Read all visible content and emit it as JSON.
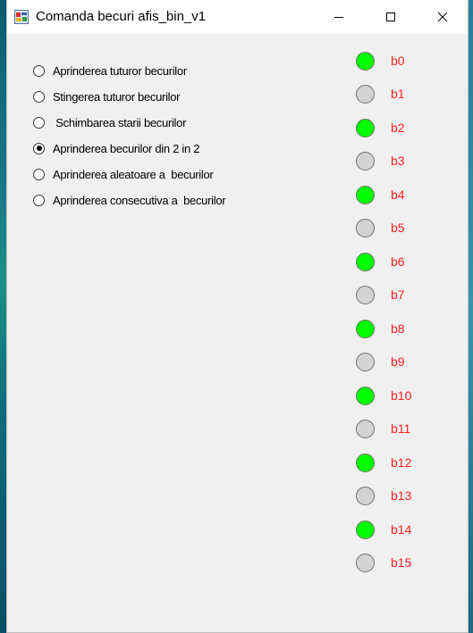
{
  "window": {
    "title": "Comanda becuri afis_bin_v1",
    "controls": {
      "minimize": "minimize",
      "maximize": "maximize",
      "close": "close"
    }
  },
  "options": [
    {
      "label": "Aprinderea tuturor becurilor",
      "checked": false
    },
    {
      "label": "Stingerea tuturor becurilor",
      "checked": false
    },
    {
      "label": " Schimbarea starii becurilor",
      "checked": false
    },
    {
      "label": "Aprinderea becurilor din 2 in 2",
      "checked": true
    },
    {
      "label": "Aprinderea aleatoare a  becurilor",
      "checked": false
    },
    {
      "label": "Aprinderea consecutiva a  becurilor",
      "checked": false
    }
  ],
  "bulbs": [
    {
      "label": "b0",
      "on": true
    },
    {
      "label": "b1",
      "on": false
    },
    {
      "label": "b2",
      "on": true
    },
    {
      "label": "b3",
      "on": false
    },
    {
      "label": "b4",
      "on": true
    },
    {
      "label": "b5",
      "on": false
    },
    {
      "label": "b6",
      "on": true
    },
    {
      "label": "b7",
      "on": false
    },
    {
      "label": "b8",
      "on": true
    },
    {
      "label": "b9",
      "on": false
    },
    {
      "label": "b10",
      "on": true
    },
    {
      "label": "b11",
      "on": false
    },
    {
      "label": "b12",
      "on": true
    },
    {
      "label": "b13",
      "on": false
    },
    {
      "label": "b14",
      "on": true
    },
    {
      "label": "b15",
      "on": false
    }
  ],
  "colors": {
    "bulb_on": "#00ff00",
    "bulb_off": "#d3d3d3",
    "bulb_label": "#ff2020"
  }
}
